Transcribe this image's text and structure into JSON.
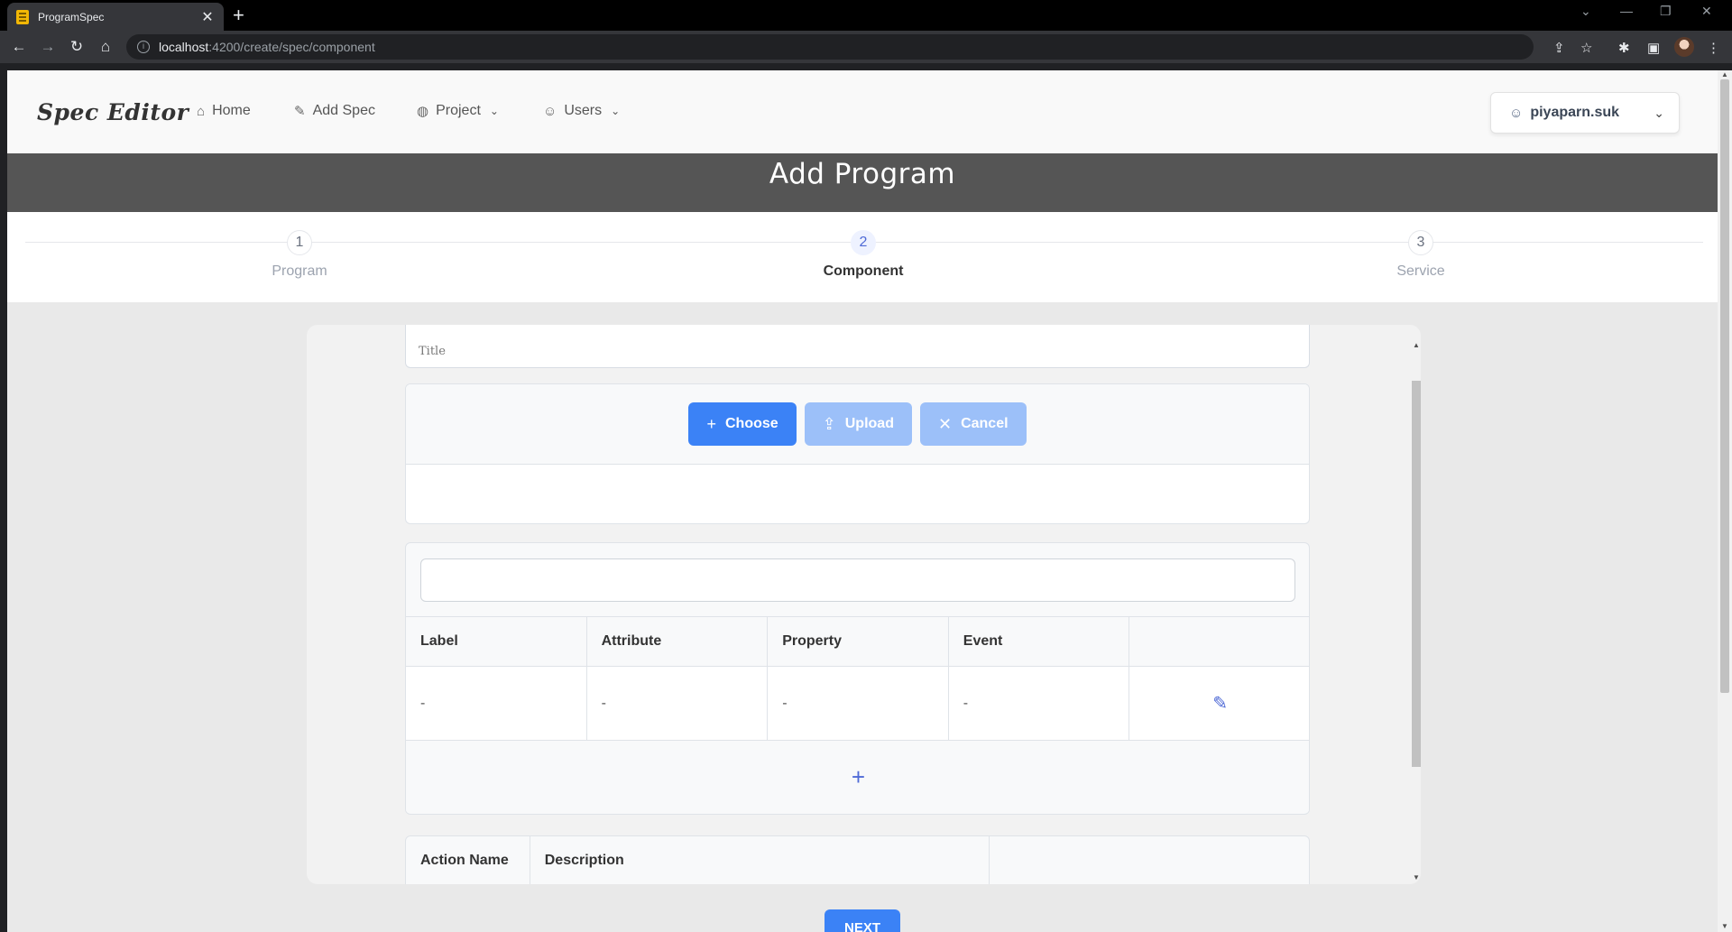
{
  "browser": {
    "tab_title": "ProgramSpec",
    "url_host": "localhost",
    "url_path": ":4200/create/spec/component"
  },
  "navbar": {
    "brand": "Spec Editor",
    "items": [
      {
        "label": "Home",
        "icon": "home-icon"
      },
      {
        "label": "Add Spec",
        "icon": "pencil-icon"
      },
      {
        "label": "Project",
        "icon": "globe-icon"
      },
      {
        "label": "Users",
        "icon": "user-icon"
      }
    ],
    "user": "piyaparn.suk"
  },
  "banner": {
    "title": "Add Program"
  },
  "steps": [
    {
      "number": "1",
      "label": "Program"
    },
    {
      "number": "2",
      "label": "Component"
    },
    {
      "number": "3",
      "label": "Service"
    }
  ],
  "form": {
    "title_placeholder": "Title",
    "upload_buttons": {
      "choose": "Choose",
      "upload": "Upload",
      "cancel": "Cancel"
    },
    "component_table": {
      "headers": [
        "Label",
        "Attribute",
        "Property",
        "Event"
      ],
      "row": [
        "-",
        "-",
        "-",
        "-"
      ]
    },
    "action_table": {
      "headers": [
        "Action Name",
        "Description"
      ]
    },
    "next_label": "NEXT"
  },
  "colors": {
    "primary": "#3b82f6",
    "banner": "#555555",
    "accent": "#4f6ad6"
  }
}
